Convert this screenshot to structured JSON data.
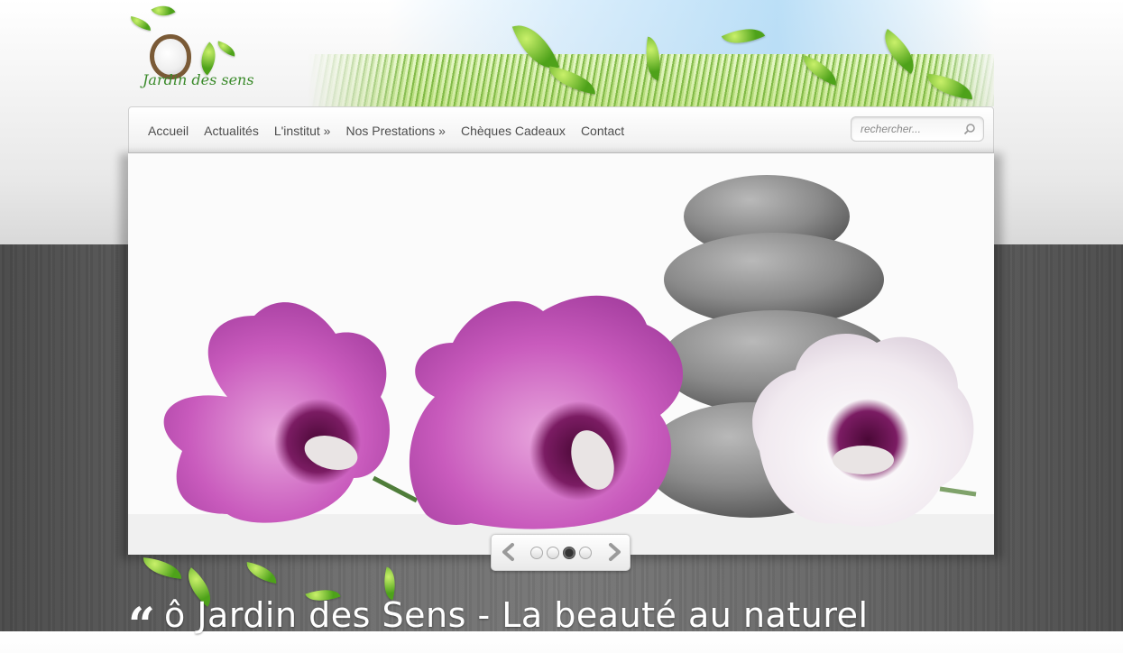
{
  "logo": {
    "text": "Jardin des sens"
  },
  "nav": {
    "items": [
      {
        "label": "Accueil"
      },
      {
        "label": "Actualités"
      },
      {
        "label": "L'institut »"
      },
      {
        "label": "Nos Prestations »"
      },
      {
        "label": "Chèques Cadeaux"
      },
      {
        "label": "Contact"
      }
    ]
  },
  "search": {
    "placeholder": "rechercher..."
  },
  "slider": {
    "slide_count": 4,
    "active_slide": 3,
    "image": "pink-hibiscus-flowers-and-zen-stones"
  },
  "heading": {
    "quote_mark": "“",
    "text": "ô Jardin des Sens - La beauté au naturel"
  },
  "colors": {
    "nav_text": "#4d4d4d",
    "wood_background": "#666666",
    "heading_text": "#ffffff"
  }
}
